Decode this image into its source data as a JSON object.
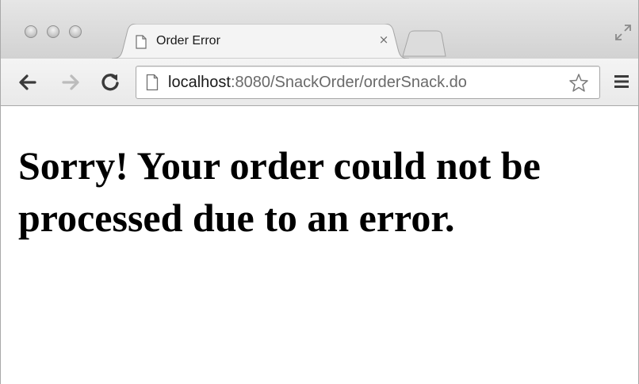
{
  "browser": {
    "tab": {
      "title": "Order Error",
      "close_glyph": "×"
    },
    "address_bar": {
      "host": "localhost",
      "path": ":8080/SnackOrder/orderSnack.do"
    },
    "icons": {
      "back": "back-arrow-icon",
      "forward": "forward-arrow-icon",
      "reload": "reload-icon",
      "page": "page-icon",
      "bookmark": "star-icon",
      "menu": "hamburger-menu-icon",
      "fullscreen": "fullscreen-icon"
    }
  },
  "page": {
    "heading": "Sorry! Your order could not be processed due to an error."
  },
  "colors": {
    "tab_strip": "#d9d9d9",
    "toolbar": "#efefef",
    "text": "#000000"
  }
}
